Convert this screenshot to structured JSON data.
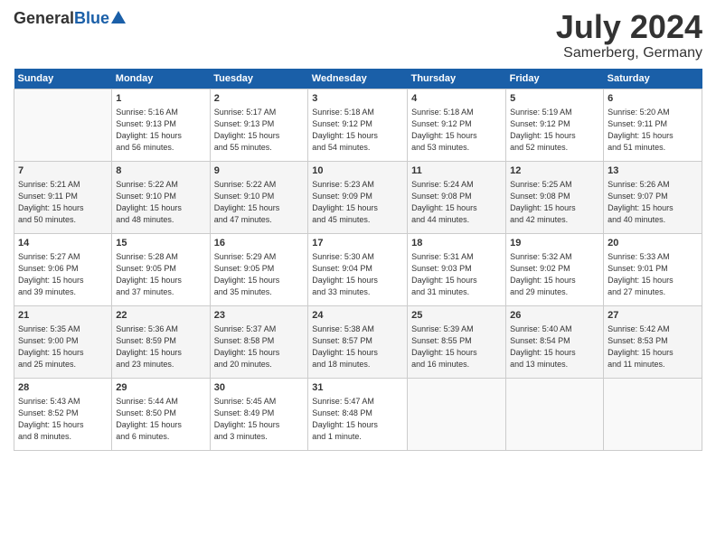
{
  "header": {
    "logo_general": "General",
    "logo_blue": "Blue",
    "month": "July 2024",
    "location": "Samerberg, Germany"
  },
  "weekdays": [
    "Sunday",
    "Monday",
    "Tuesday",
    "Wednesday",
    "Thursday",
    "Friday",
    "Saturday"
  ],
  "weeks": [
    [
      {
        "day": "",
        "info": ""
      },
      {
        "day": "1",
        "info": "Sunrise: 5:16 AM\nSunset: 9:13 PM\nDaylight: 15 hours\nand 56 minutes."
      },
      {
        "day": "2",
        "info": "Sunrise: 5:17 AM\nSunset: 9:13 PM\nDaylight: 15 hours\nand 55 minutes."
      },
      {
        "day": "3",
        "info": "Sunrise: 5:18 AM\nSunset: 9:12 PM\nDaylight: 15 hours\nand 54 minutes."
      },
      {
        "day": "4",
        "info": "Sunrise: 5:18 AM\nSunset: 9:12 PM\nDaylight: 15 hours\nand 53 minutes."
      },
      {
        "day": "5",
        "info": "Sunrise: 5:19 AM\nSunset: 9:12 PM\nDaylight: 15 hours\nand 52 minutes."
      },
      {
        "day": "6",
        "info": "Sunrise: 5:20 AM\nSunset: 9:11 PM\nDaylight: 15 hours\nand 51 minutes."
      }
    ],
    [
      {
        "day": "7",
        "info": "Sunrise: 5:21 AM\nSunset: 9:11 PM\nDaylight: 15 hours\nand 50 minutes."
      },
      {
        "day": "8",
        "info": "Sunrise: 5:22 AM\nSunset: 9:10 PM\nDaylight: 15 hours\nand 48 minutes."
      },
      {
        "day": "9",
        "info": "Sunrise: 5:22 AM\nSunset: 9:10 PM\nDaylight: 15 hours\nand 47 minutes."
      },
      {
        "day": "10",
        "info": "Sunrise: 5:23 AM\nSunset: 9:09 PM\nDaylight: 15 hours\nand 45 minutes."
      },
      {
        "day": "11",
        "info": "Sunrise: 5:24 AM\nSunset: 9:08 PM\nDaylight: 15 hours\nand 44 minutes."
      },
      {
        "day": "12",
        "info": "Sunrise: 5:25 AM\nSunset: 9:08 PM\nDaylight: 15 hours\nand 42 minutes."
      },
      {
        "day": "13",
        "info": "Sunrise: 5:26 AM\nSunset: 9:07 PM\nDaylight: 15 hours\nand 40 minutes."
      }
    ],
    [
      {
        "day": "14",
        "info": "Sunrise: 5:27 AM\nSunset: 9:06 PM\nDaylight: 15 hours\nand 39 minutes."
      },
      {
        "day": "15",
        "info": "Sunrise: 5:28 AM\nSunset: 9:05 PM\nDaylight: 15 hours\nand 37 minutes."
      },
      {
        "day": "16",
        "info": "Sunrise: 5:29 AM\nSunset: 9:05 PM\nDaylight: 15 hours\nand 35 minutes."
      },
      {
        "day": "17",
        "info": "Sunrise: 5:30 AM\nSunset: 9:04 PM\nDaylight: 15 hours\nand 33 minutes."
      },
      {
        "day": "18",
        "info": "Sunrise: 5:31 AM\nSunset: 9:03 PM\nDaylight: 15 hours\nand 31 minutes."
      },
      {
        "day": "19",
        "info": "Sunrise: 5:32 AM\nSunset: 9:02 PM\nDaylight: 15 hours\nand 29 minutes."
      },
      {
        "day": "20",
        "info": "Sunrise: 5:33 AM\nSunset: 9:01 PM\nDaylight: 15 hours\nand 27 minutes."
      }
    ],
    [
      {
        "day": "21",
        "info": "Sunrise: 5:35 AM\nSunset: 9:00 PM\nDaylight: 15 hours\nand 25 minutes."
      },
      {
        "day": "22",
        "info": "Sunrise: 5:36 AM\nSunset: 8:59 PM\nDaylight: 15 hours\nand 23 minutes."
      },
      {
        "day": "23",
        "info": "Sunrise: 5:37 AM\nSunset: 8:58 PM\nDaylight: 15 hours\nand 20 minutes."
      },
      {
        "day": "24",
        "info": "Sunrise: 5:38 AM\nSunset: 8:57 PM\nDaylight: 15 hours\nand 18 minutes."
      },
      {
        "day": "25",
        "info": "Sunrise: 5:39 AM\nSunset: 8:55 PM\nDaylight: 15 hours\nand 16 minutes."
      },
      {
        "day": "26",
        "info": "Sunrise: 5:40 AM\nSunset: 8:54 PM\nDaylight: 15 hours\nand 13 minutes."
      },
      {
        "day": "27",
        "info": "Sunrise: 5:42 AM\nSunset: 8:53 PM\nDaylight: 15 hours\nand 11 minutes."
      }
    ],
    [
      {
        "day": "28",
        "info": "Sunrise: 5:43 AM\nSunset: 8:52 PM\nDaylight: 15 hours\nand 8 minutes."
      },
      {
        "day": "29",
        "info": "Sunrise: 5:44 AM\nSunset: 8:50 PM\nDaylight: 15 hours\nand 6 minutes."
      },
      {
        "day": "30",
        "info": "Sunrise: 5:45 AM\nSunset: 8:49 PM\nDaylight: 15 hours\nand 3 minutes."
      },
      {
        "day": "31",
        "info": "Sunrise: 5:47 AM\nSunset: 8:48 PM\nDaylight: 15 hours\nand 1 minute."
      },
      {
        "day": "",
        "info": ""
      },
      {
        "day": "",
        "info": ""
      },
      {
        "day": "",
        "info": ""
      }
    ]
  ]
}
